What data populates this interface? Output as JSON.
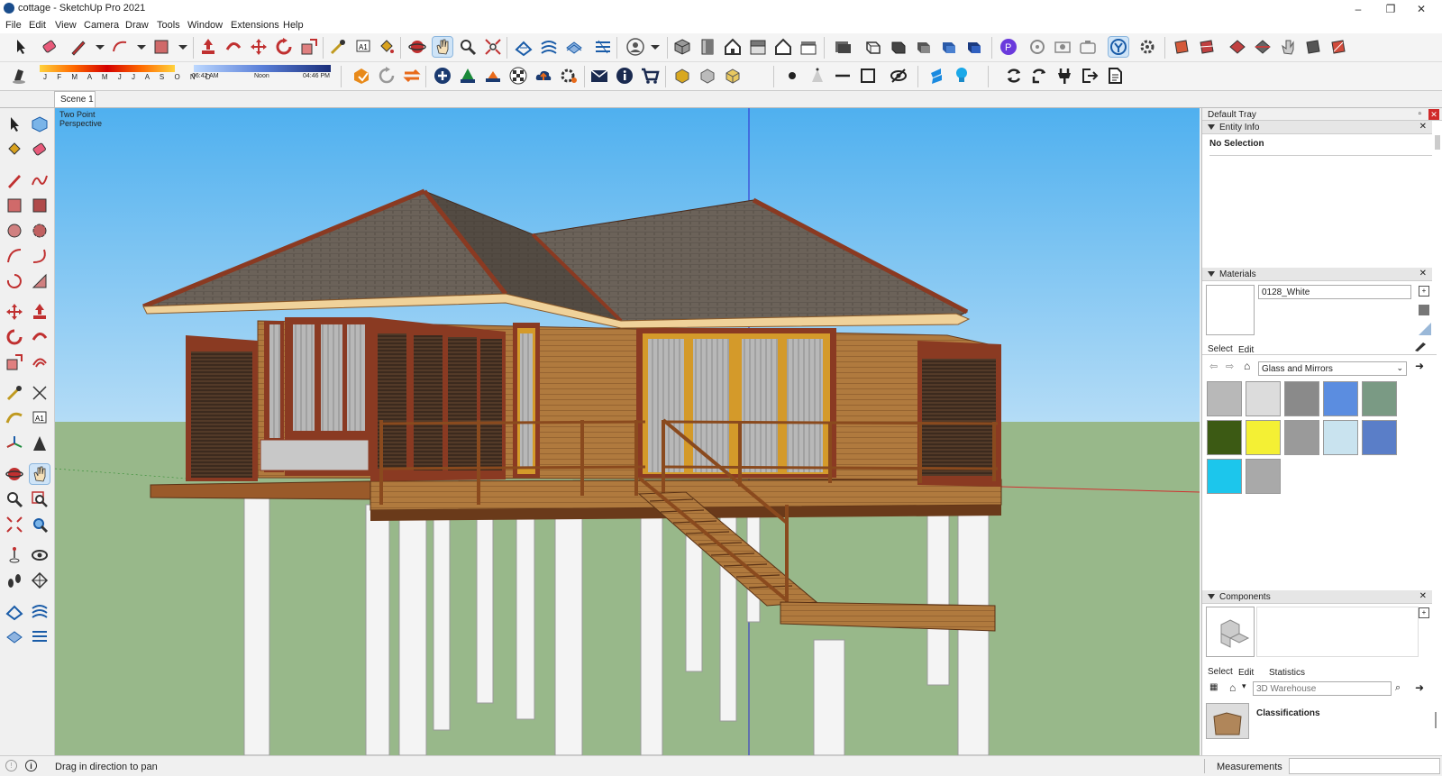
{
  "window": {
    "title": "cottage - SketchUp Pro 2021"
  },
  "menu": [
    "File",
    "Edit",
    "View",
    "Camera",
    "Draw",
    "Tools",
    "Window",
    "Extensions",
    "Help"
  ],
  "shadow": {
    "months": "J F M A M J J A S O N D",
    "time_start": "06:42 AM",
    "time_mid": "Noon",
    "time_end": "04:46 PM"
  },
  "scene": {
    "tab": "Scene 1"
  },
  "viewport": {
    "camera_line1": "Two Point",
    "camera_line2": "Perspective"
  },
  "tray": {
    "title": "Default Tray",
    "entity_info": {
      "header": "Entity Info",
      "status": "No Selection"
    },
    "materials": {
      "header": "Materials",
      "current_name": "0128_White",
      "tab_select": "Select",
      "tab_edit": "Edit",
      "library": "Glass and Mirrors",
      "swatches": [
        "#b8b8b8",
        "#dcdcdc",
        "#8a8a8a",
        "#5b8de0",
        "#7a9a84",
        "#3c5a14",
        "#f4f034",
        "#9a9a9a",
        "#c9e3ef",
        "#5a7ec8",
        "#1cc6ec",
        "#a9a9a9"
      ]
    },
    "components": {
      "header": "Components",
      "tab_select": "Select",
      "tab_edit": "Edit",
      "tab_statistics": "Statistics",
      "search_placeholder": "3D Warehouse",
      "result_title": "Classifications"
    }
  },
  "status": {
    "hint": "Drag in direction to pan",
    "measurements_label": "Measurements"
  },
  "colors": {
    "sky_top": "#55b3f0",
    "sky_bottom": "#a6d6f5",
    "ground": "#98b88a",
    "roof": "#6c6258",
    "wood": "#a96a36",
    "trim": "#8a3a22"
  }
}
